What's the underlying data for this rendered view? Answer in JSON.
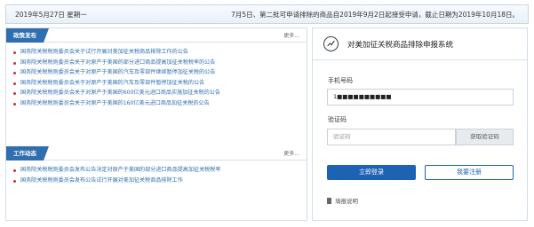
{
  "topbar": {
    "date": "2019年5月27日  星期一",
    "notice": "7月5日、第二批可申请排除的商品自2019年9月2日起接受申请，截止日期为2019年10月18日。"
  },
  "policy": {
    "tag": "政策发布",
    "more": "更多...",
    "items": [
      "国务院关税税则委员会关于试行开展对美加征关税商品排除工作的公告",
      "国务院关税税则委员会关于对原产于美国的部分进口商品提高加征关税税率的公告",
      "国务院关税税则委员会关于对原产于美国的汽车及零部件继续暂停加征关税的公告",
      "国务院关税税则委员会关于对原产于美国的汽车及零部件暂停加征关税的公告",
      "国务院关税税则委员会关于对原产于美国的600亿美元进口商品实施加征关税的公告",
      "国务院关税税则委员会关于对原产于美国的160亿美元进口商品加征关税的公告"
    ]
  },
  "work": {
    "tag": "工作动态",
    "more": "更多...",
    "items": [
      "国务院关税税则委员会发布公告决定对原产于美国的部分进口商品提高加征关税税率",
      "国务院关税税则委员会发布公告试行开展对美加征关税商品排除工作"
    ]
  },
  "login": {
    "title": "对美加征关税商品排除申报系统",
    "phone_label": "手机号码",
    "phone_value": "1■■■■■■■■■■",
    "code_label": "验证码",
    "code_placeholder": "验证码",
    "code_button": "获取验证码",
    "login_button": "立即登录",
    "register_button": "我要注册",
    "help": "填报说明"
  },
  "colors": {
    "accent": "#1e62b4",
    "tag": "#2f6fb0",
    "bullet": "#c9302c"
  }
}
